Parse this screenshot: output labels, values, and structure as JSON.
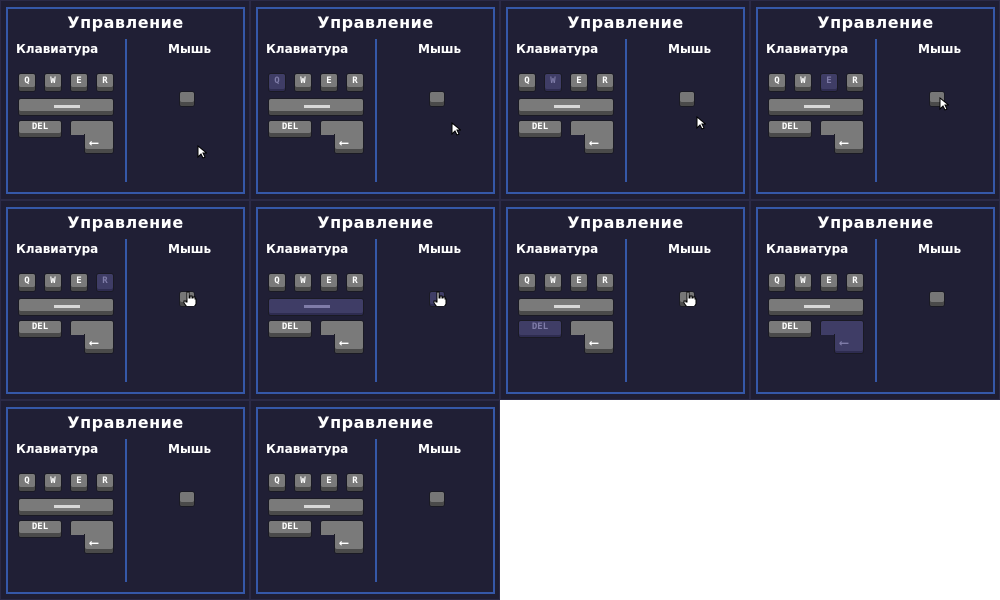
{
  "labels": {
    "title": "Управление",
    "keyboard": "Клавиатура",
    "mouse": "Мышь",
    "keys": {
      "q": "Q",
      "w": "W",
      "e": "E",
      "r": "R",
      "del": "DEL",
      "enter": "⟵"
    }
  },
  "colors": {
    "panel_bg": "#201f35",
    "panel_border": "#3558a8",
    "key": "#7a7a7a",
    "key_pressed": "#3f3d66"
  },
  "frames": [
    {
      "pressed": [],
      "cursor": "arrow",
      "cursor_on": "none"
    },
    {
      "pressed": [
        "q"
      ],
      "cursor": "arrow",
      "cursor_on": "none"
    },
    {
      "pressed": [
        "w"
      ],
      "cursor": "arrow",
      "cursor_on": "none"
    },
    {
      "pressed": [
        "e"
      ],
      "cursor": "arrow",
      "cursor_on": "mouse"
    },
    {
      "pressed": [
        "r"
      ],
      "cursor": "hand",
      "cursor_on": "mouse"
    },
    {
      "pressed": [
        "space",
        "mouse"
      ],
      "cursor": "hand",
      "cursor_on": "mouse"
    },
    {
      "pressed": [
        "del"
      ],
      "cursor": "hand",
      "cursor_on": "mouse"
    },
    {
      "pressed": [
        "enter"
      ],
      "cursor": "none",
      "cursor_on": "none"
    },
    {
      "pressed": [],
      "cursor": "none",
      "cursor_on": "none"
    },
    {
      "pressed": [],
      "cursor": "none",
      "cursor_on": "none"
    }
  ]
}
